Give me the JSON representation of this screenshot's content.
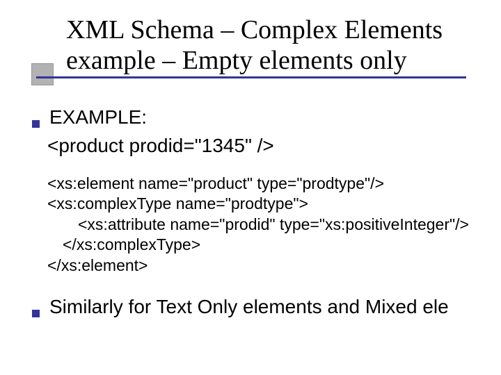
{
  "title": {
    "line1": "XML Schema – Complex Elements",
    "line2": "example – Empty elements only"
  },
  "body": {
    "example_label": "EXAMPLE:",
    "example_code": "<product prodid=\"1345\" />",
    "schema": {
      "l1": "<xs:element name=\"product\" type=\"prodtype\"/>",
      "l2": "<xs:complexType name=\"prodtype\">",
      "l3": "<xs:attribute name=\"prodid\" type=\"xs:positiveInteger\"/>",
      "l4": "</xs:complexType>",
      "l5": "</xs:element>"
    },
    "footer_bullet": "Similarly for Text Only elements and Mixed ele"
  }
}
